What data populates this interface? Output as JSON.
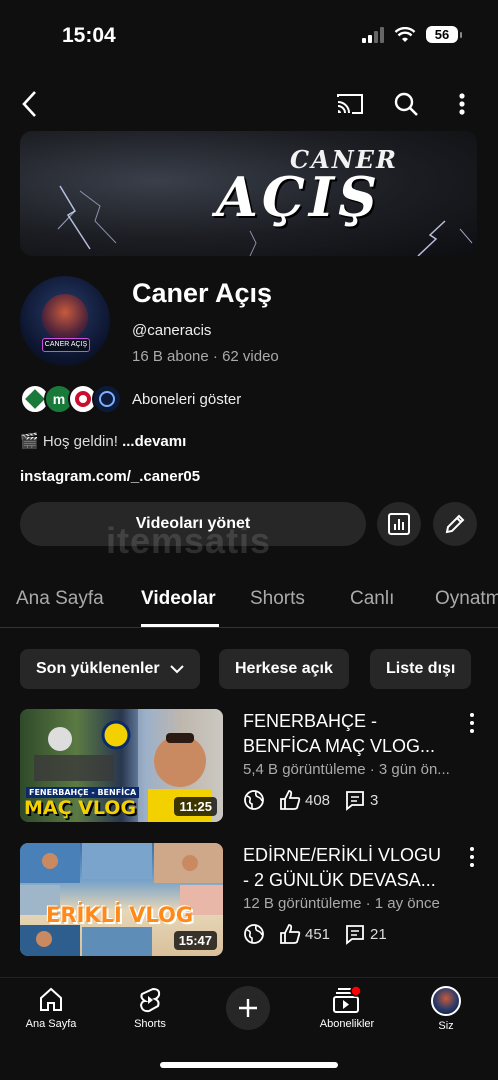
{
  "status": {
    "time": "15:04",
    "battery": "56"
  },
  "nav": {
    "back_icon": "chevron-left-icon",
    "cast_icon": "cast-icon",
    "search_icon": "search-icon",
    "more_icon": "more-vertical-icon"
  },
  "banner": {
    "line1": "CANER",
    "line2": "AÇIŞ"
  },
  "avatar": {
    "tag": "CANER AÇIŞ"
  },
  "channel": {
    "name": "Caner Açış",
    "handle": "@caneracis",
    "stats": "16 B abone · 62 video",
    "subscribers_label": "Aboneleri göster",
    "description_prefix": "🎬 Hoş geldin! ",
    "description_more": "...devamı",
    "link": "instagram.com/_.caner05"
  },
  "actions": {
    "manage_videos": "Videoları yönet",
    "analytics_icon": "analytics-icon",
    "edit_icon": "pencil-icon"
  },
  "watermark": "itemsatis",
  "tabs": [
    "Ana Sayfa",
    "Videolar",
    "Shorts",
    "Canlı",
    "Oynatma"
  ],
  "active_tab": "Videolar",
  "filters": {
    "sort": "Son yüklenenler",
    "public": "Herkese açık",
    "unlisted": "Liste dışı"
  },
  "videos": [
    {
      "title_line1": "FENERBAHÇE -",
      "title_line2": "BENFİCA MAÇ VLOG...",
      "meta": "5,4 B görüntüleme · 3 gün ön...",
      "duration": "11:25",
      "likes": "408",
      "comments": "3",
      "thumb_caption_small": "FENERBAHÇE - BENFİCA",
      "thumb_caption_big": "MAÇ VLOG"
    },
    {
      "title_line1": "EDİRNE/ERİKLİ VLOGU",
      "title_line2": "- 2 GÜNLÜK DEVASA...",
      "meta": "12 B görüntüleme · 1 ay önce",
      "duration": "15:47",
      "likes": "451",
      "comments": "21",
      "thumb_caption_big": "ERİKLİ VLOG"
    }
  ],
  "bottom_nav": {
    "home": "Ana Sayfa",
    "shorts": "Shorts",
    "subscriptions": "Abonelikler",
    "you": "Siz"
  },
  "colors": {
    "background": "#0f0f0f",
    "surface": "#272727",
    "notification": "#ff0000"
  }
}
